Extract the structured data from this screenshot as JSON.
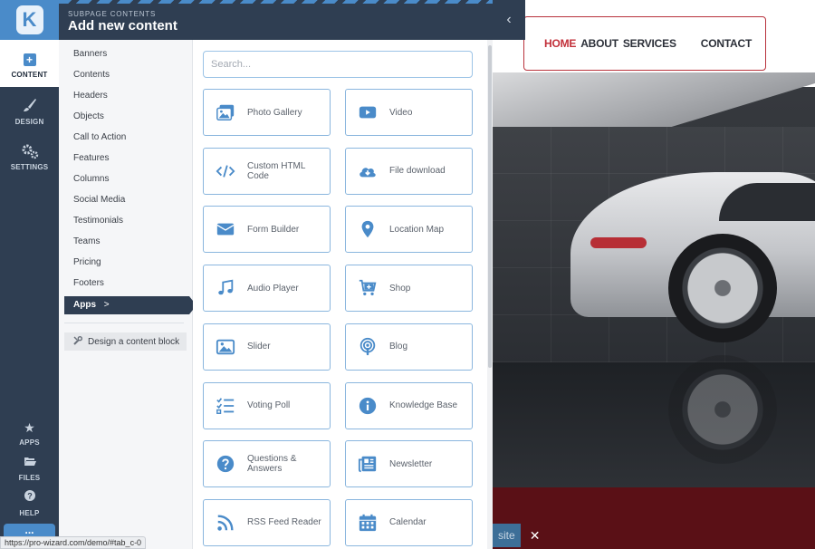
{
  "header": {
    "subtitle": "SUBPAGE CONTENTS",
    "title": "Add new content"
  },
  "rail": {
    "logo": "K",
    "content": "CONTENT",
    "design": "DESIGN",
    "settings": "SETTINGS",
    "apps": "APPS",
    "files": "FILES",
    "help": "HELP",
    "more": "..."
  },
  "categories": {
    "items": [
      "Banners",
      "Contents",
      "Headers",
      "Objects",
      "Call to Action",
      "Features",
      "Columns",
      "Social Media",
      "Testimonials",
      "Teams",
      "Pricing",
      "Footers"
    ],
    "active": "Apps",
    "active_chevron": ">",
    "design_button": "Design a content block"
  },
  "search": {
    "placeholder": "Search..."
  },
  "tiles": [
    {
      "label": "Photo Gallery",
      "icon": "photo-gallery-icon"
    },
    {
      "label": "Video",
      "icon": "video-icon"
    },
    {
      "label": "Custom HTML Code",
      "icon": "code-icon"
    },
    {
      "label": "File download",
      "icon": "cloud-download-icon"
    },
    {
      "label": "Form Builder",
      "icon": "envelope-icon"
    },
    {
      "label": "Location Map",
      "icon": "map-marker-icon"
    },
    {
      "label": "Audio Player",
      "icon": "music-note-icon"
    },
    {
      "label": "Shop",
      "icon": "cart-icon"
    },
    {
      "label": "Slider",
      "icon": "image-icon"
    },
    {
      "label": "Blog",
      "icon": "podcast-icon"
    },
    {
      "label": "Voting Poll",
      "icon": "checklist-icon"
    },
    {
      "label": "Knowledge Base",
      "icon": "info-icon"
    },
    {
      "label": "Questions & Answers",
      "icon": "question-icon"
    },
    {
      "label": "Newsletter",
      "icon": "newspaper-icon"
    },
    {
      "label": "RSS Feed Reader",
      "icon": "rss-icon"
    },
    {
      "label": "Calendar",
      "icon": "calendar-icon"
    }
  ],
  "preview": {
    "nav": [
      "HOME",
      "ABOUT",
      "SERVICES",
      "CONTACT"
    ],
    "publish_text": "site",
    "close": "✕",
    "collapse": "‹"
  },
  "status_url": "https://pro-wizard.com/demo/#tab_c-0",
  "colors": {
    "accent": "#4a8bc9",
    "dark": "#2f3e52",
    "brand_red": "#c2303a"
  }
}
